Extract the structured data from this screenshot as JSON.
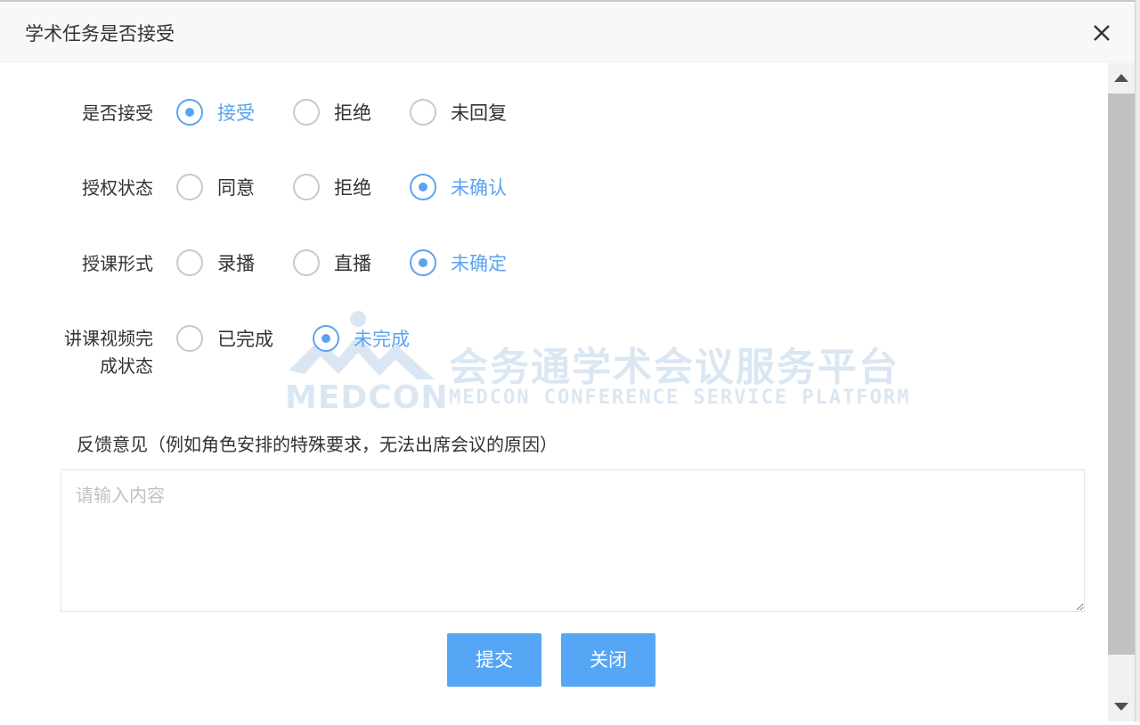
{
  "dialog": {
    "title": "学术任务是否接受"
  },
  "form": {
    "rows": [
      {
        "label": "是否接受",
        "options": [
          {
            "label": "接受",
            "checked": true
          },
          {
            "label": "拒绝",
            "checked": false
          },
          {
            "label": "未回复",
            "checked": false
          }
        ]
      },
      {
        "label": "授权状态",
        "options": [
          {
            "label": "同意",
            "checked": false
          },
          {
            "label": "拒绝",
            "checked": false
          },
          {
            "label": "未确认",
            "checked": true
          }
        ]
      },
      {
        "label": "授课形式",
        "options": [
          {
            "label": "录播",
            "checked": false
          },
          {
            "label": "直播",
            "checked": false
          },
          {
            "label": "未确定",
            "checked": true
          }
        ]
      },
      {
        "label_line1": "讲课视频完",
        "label_line2": "成状态",
        "options": [
          {
            "label": "已完成",
            "checked": false
          },
          {
            "label": "未完成",
            "checked": true
          }
        ]
      }
    ],
    "feedback_label": "反馈意见（例如角色安排的特殊要求，无法出席会议的原因）",
    "feedback_placeholder": "请输入内容",
    "feedback_value": ""
  },
  "watermark": {
    "cn": "会务通学术会议服务平台",
    "brand": "MEDCON",
    "en": "MEDCON CONFERENCE SERVICE PLATFORM"
  },
  "buttons": {
    "submit": "提交",
    "close": "关闭"
  },
  "colors": {
    "accent": "#5aa3f2",
    "button": "#55a6f5"
  }
}
